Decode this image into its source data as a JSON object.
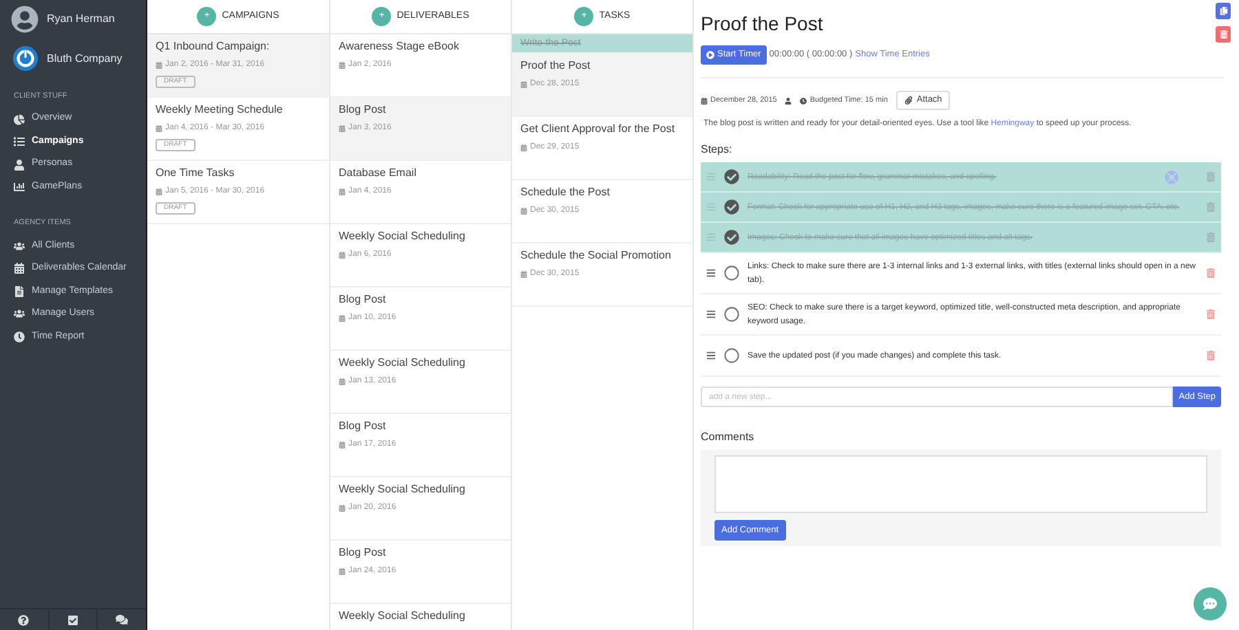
{
  "sidebar": {
    "user": "Ryan Herman",
    "company": "Bluth Company",
    "sections": [
      {
        "title": "CLIENT STUFF",
        "items": [
          {
            "label": "Overview",
            "selected": false
          },
          {
            "label": "Campaigns",
            "selected": true
          },
          {
            "label": "Personas",
            "selected": false
          },
          {
            "label": "GamePlans",
            "selected": false
          }
        ]
      },
      {
        "title": "AGENCY ITEMS",
        "items": [
          {
            "label": "All Clients",
            "selected": false
          },
          {
            "label": "Deliverables Calendar",
            "selected": false
          },
          {
            "label": "Manage Templates",
            "selected": false
          },
          {
            "label": "Manage Users",
            "selected": false
          },
          {
            "label": "Time Report",
            "selected": false
          }
        ]
      }
    ]
  },
  "columns": [
    {
      "title": "CAMPAIGNS",
      "add_label": "+",
      "items": [
        {
          "title": "Q1 Inbound Campaign:",
          "date": "Jan 2, 2016 - Mar 31, 2016",
          "badge": "DRAFT",
          "selected": true
        },
        {
          "title": "Weekly Meeting Schedule",
          "date": "Jan 4, 2016 - Mar 30, 2016",
          "badge": "DRAFT",
          "selected": false
        },
        {
          "title": "One Time Tasks",
          "date": "Jan 5, 2016 - Mar 30, 2016",
          "badge": "DRAFT",
          "selected": false
        }
      ]
    },
    {
      "title": "DELIVERABLES",
      "add_label": "+",
      "items": [
        {
          "title": "Awareness Stage eBook",
          "date": "Jan 2, 2016",
          "selected": false
        },
        {
          "title": "Blog Post",
          "date": "Jan 3, 2016",
          "selected": true
        },
        {
          "title": "Database Email",
          "date": "Jan 4, 2016",
          "selected": false
        },
        {
          "title": "Weekly Social Scheduling",
          "date": "Jan 6, 2016",
          "selected": false
        },
        {
          "title": "Blog Post",
          "date": "Jan 10, 2016",
          "selected": false
        },
        {
          "title": "Weekly Social Scheduling",
          "date": "Jan 13, 2016",
          "selected": false
        },
        {
          "title": "Blog Post",
          "date": "Jan 17, 2016",
          "selected": false
        },
        {
          "title": "Weekly Social Scheduling",
          "date": "Jan 20, 2016",
          "selected": false
        },
        {
          "title": "Blog Post",
          "date": "Jan 24, 2016",
          "selected": false
        },
        {
          "title": "Weekly Social Scheduling",
          "selected": false
        }
      ]
    },
    {
      "title": "TASKS",
      "add_label": "+",
      "items": [
        {
          "title": "Write the Post",
          "completed": true
        },
        {
          "title": "Proof the Post",
          "date": "Dec 28, 2015",
          "completed": false,
          "selected": true
        },
        {
          "title": "Get Client Approval for the Post",
          "date": "Dec 29, 2015",
          "completed": false,
          "selected": false
        },
        {
          "title": "Schedule the Post",
          "date": "Dec 30, 2015",
          "completed": false,
          "selected": false
        },
        {
          "title": "Schedule the Social Promotion",
          "date": "Dec 30, 2015",
          "completed": false,
          "selected": false
        }
      ]
    }
  ],
  "detail": {
    "title": "Proof the Post",
    "timer_button": "Start Timer",
    "timer": "00:00:00 ( 00:00:00 )",
    "time_entries_link": "Show Time Entries",
    "date": "December 28, 2015",
    "budget": "Budgeted Time: 15 min",
    "attach_button": "Attach",
    "description": "The blog post is written and ready for your detail-oriented eyes. Use a tool like",
    "description_link": "Hemingway",
    "description_end": "to speed up your process.",
    "steps_title": "Steps:",
    "steps": [
      {
        "text": "Readability: Read the post for flow, grammar mistakes, and spelling.",
        "checked": true,
        "hovered": true
      },
      {
        "text": "Format: Check for appropriate use of H1, H2, and H3 tags, images, make sure there is a featured image set, CTA, etc.",
        "checked": true,
        "hovered": false
      },
      {
        "text": "Images: Check to make sure that all images have optimized titles and alt tags.",
        "checked": true,
        "hovered": false
      },
      {
        "text": "Links: Check to make sure there are 1-3 internal links and 1-3 external links, with titles (external links should open in a new tab).",
        "checked": false,
        "hovered": false
      },
      {
        "text": "SEO: Check to make sure there is a target keyword, optimized title, well-constructed meta description, and appropriate keyword usage.",
        "checked": false,
        "hovered": false
      },
      {
        "text": "Save the updated post (if you made changes) and complete this task.",
        "checked": false,
        "hovered": false
      }
    ],
    "new_step_placeholder": "add a new step...",
    "add_step_button": "Add Step",
    "comments_title": "Comments",
    "add_comment_button": "Add Comment"
  }
}
